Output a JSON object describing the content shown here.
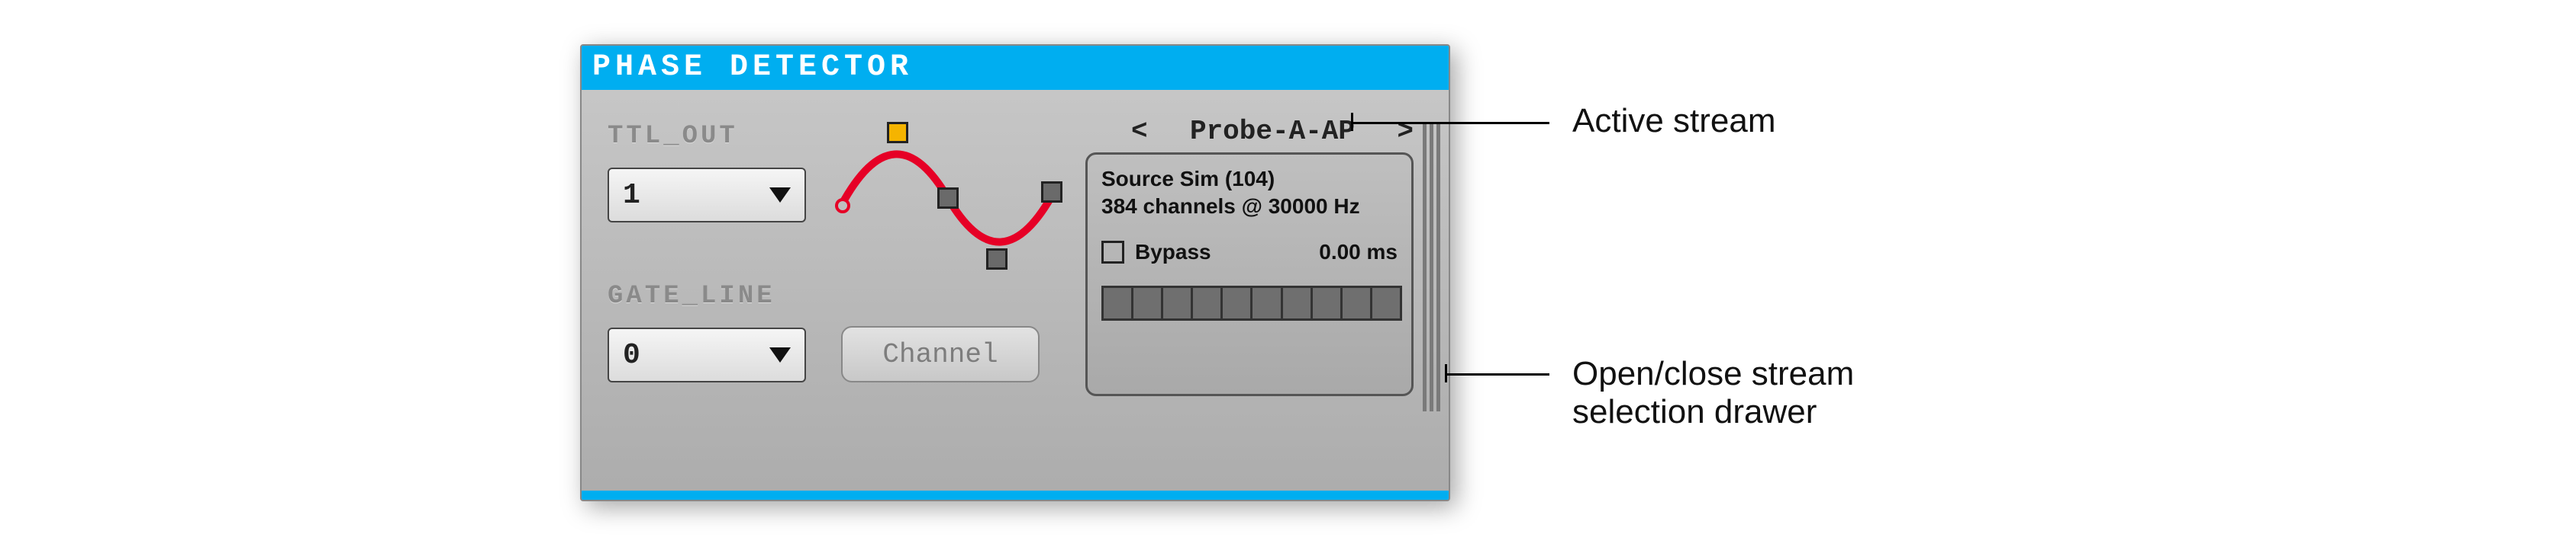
{
  "panel": {
    "title": "PHASE  DETECTOR",
    "ttl_out_label": "TTL_OUT",
    "ttl_out_value": "1",
    "gate_line_label": "GATE_LINE",
    "gate_line_value": "0",
    "channel_button": "Channel"
  },
  "stream": {
    "prev_arrow": "<",
    "name": "Probe-A-AP",
    "next_arrow": ">"
  },
  "info": {
    "source": "Source Sim (104)",
    "channels": "384 channels @ 30000 Hz",
    "bypass_label": "Bypass",
    "latency": "0.00 ms"
  },
  "annotations": {
    "active_stream": "Active stream",
    "drawer": "Open/close stream selection drawer"
  }
}
